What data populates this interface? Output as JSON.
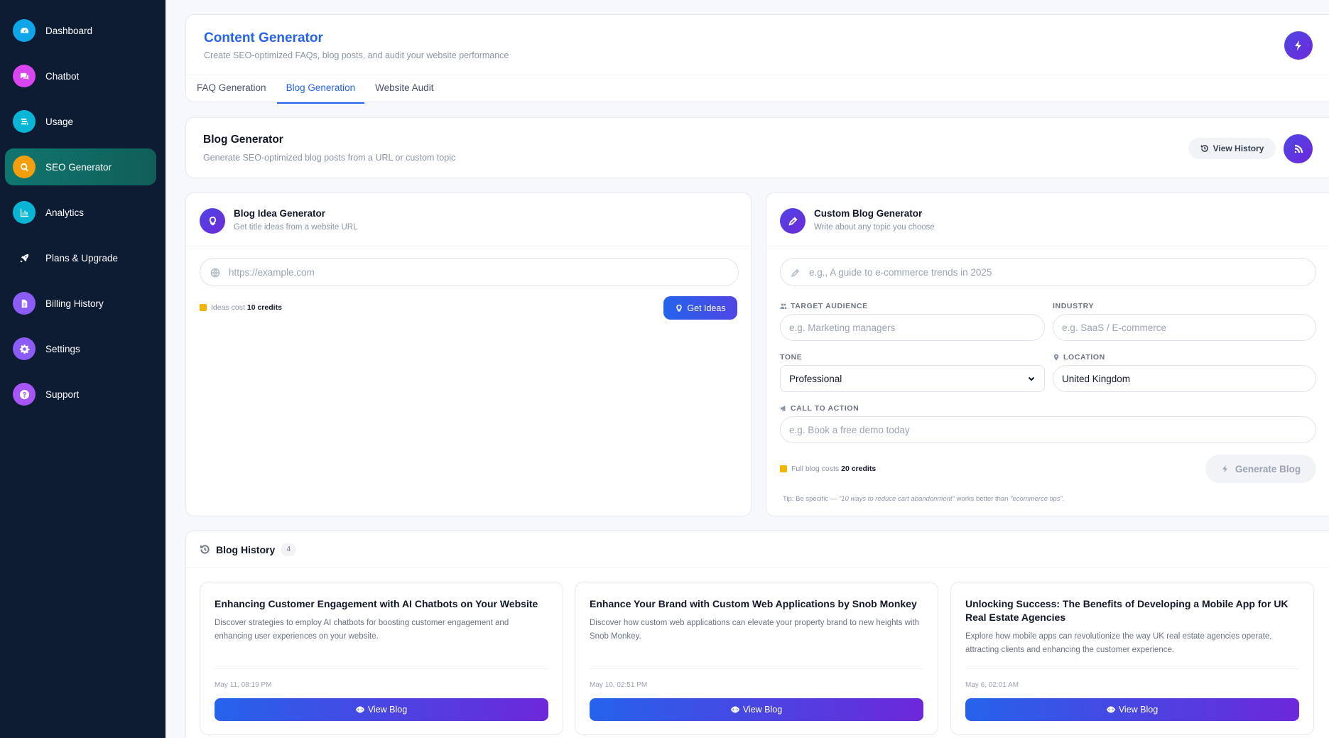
{
  "sidebar": {
    "items": [
      {
        "label": "Dashboard",
        "icon": "dashboard-icon",
        "color": "#0ea5e9"
      },
      {
        "label": "Chatbot",
        "icon": "chat-icon",
        "color": "#d946ef"
      },
      {
        "label": "Usage",
        "icon": "stack-icon",
        "color": "#06b6d4"
      },
      {
        "label": "SEO Generator",
        "icon": "search-icon",
        "color": "#f59e0b"
      },
      {
        "label": "Analytics",
        "icon": "chart-icon",
        "color": "#06b6d4"
      },
      {
        "label": "Plans & Upgrade",
        "icon": "rocket-icon",
        "color": "#0d1b33"
      },
      {
        "label": "Billing History",
        "icon": "document-icon",
        "color": "#8b5cf6"
      },
      {
        "label": "Settings",
        "icon": "gear-icon",
        "color": "#8b5cf6"
      },
      {
        "label": "Support",
        "icon": "help-icon",
        "color": "#a855f7"
      }
    ],
    "active_index": 3
  },
  "header": {
    "title": "Content Generator",
    "subtitle": "Create SEO-optimized FAQs, blog posts, and audit your website performance",
    "tabs": [
      "FAQ Generation",
      "Blog Generation",
      "Website Audit"
    ],
    "active_tab": 1
  },
  "blog_generator": {
    "title": "Blog Generator",
    "subtitle": "Generate SEO-optimized blog posts from a URL or custom topic",
    "history_button": "View History"
  },
  "idea_generator": {
    "title": "Blog Idea Generator",
    "subtitle": "Get title ideas from a website URL",
    "url_placeholder": "https://example.com",
    "cost_prefix": "Ideas cost",
    "cost_value": "10 credits",
    "button": "Get Ideas"
  },
  "custom_generator": {
    "title": "Custom Blog Generator",
    "subtitle": "Write about any topic you choose",
    "topic_placeholder": "e.g., A guide to e-commerce trends in 2025",
    "audience_label": "TARGET AUDIENCE",
    "audience_placeholder": "e.g. Marketing managers",
    "industry_label": "INDUSTRY",
    "industry_placeholder": "e.g. SaaS / E-commerce",
    "tone_label": "TONE",
    "tone_value": "Professional",
    "location_label": "LOCATION",
    "location_value": "United Kingdom",
    "cta_label": "CALL TO ACTION",
    "cta_placeholder": "e.g. Book a free demo today",
    "cost_prefix": "Full blog costs",
    "cost_value": "20 credits",
    "button": "Generate Blog",
    "tip_prefix": "Tip: Be specific — ",
    "tip_example_good": "\"10 ways to reduce cart abandonment\"",
    "tip_middle": " works better than ",
    "tip_example_bad": "\"ecommerce tips\"",
    "tip_suffix": "."
  },
  "history": {
    "title": "Blog History",
    "count": "4",
    "view_label": "View Blog",
    "posts": [
      {
        "title": "Enhancing Customer Engagement with AI Chatbots on Your Website",
        "description": "Discover strategies to employ AI chatbots for boosting customer engagement and enhancing user experiences on your website.",
        "date": "May 11, 08:19 PM"
      },
      {
        "title": "Enhance Your Brand with Custom Web Applications by Snob Monkey",
        "description": "Discover how custom web applications can elevate your property brand to new heights with Snob Monkey.",
        "date": "May 10, 02:51 PM"
      },
      {
        "title": "Unlocking Success: The Benefits of Developing a Mobile App for UK Real Estate Agencies",
        "description": "Explore how mobile apps can revolutionize the way UK real estate agencies operate, attracting clients and enhancing the customer experience.",
        "date": "May 6, 02:01 AM"
      }
    ]
  }
}
